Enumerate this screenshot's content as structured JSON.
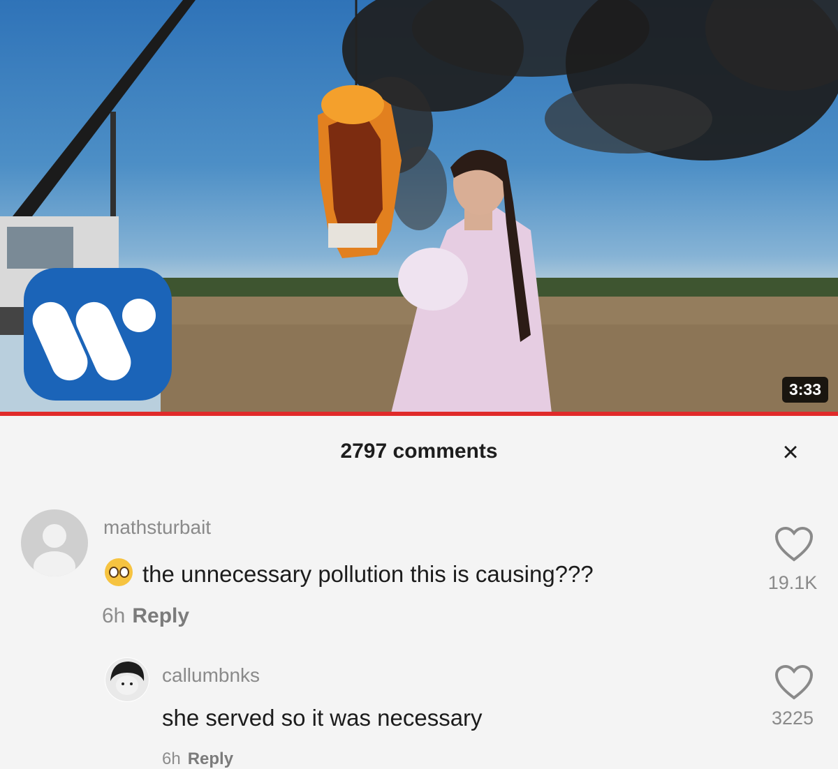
{
  "video": {
    "duration": "3:33",
    "logo_icon": "warner-music-w-icon",
    "progress_fraction": 1.0,
    "accent_color": "#e02a2a"
  },
  "comments_panel": {
    "count_label": "2797 comments",
    "close_label": "×",
    "comments": [
      {
        "username": "mathsturbait",
        "emoji": "pleading-face-emoji",
        "text": "the unnecessary pollution this is causing???",
        "age": "6h",
        "reply_label": "Reply",
        "likes": "19.1K"
      },
      {
        "username": "callumbnks",
        "text": "she served so it was necessary",
        "age": "6h",
        "reply_label": "Reply",
        "likes": "3225"
      }
    ]
  }
}
